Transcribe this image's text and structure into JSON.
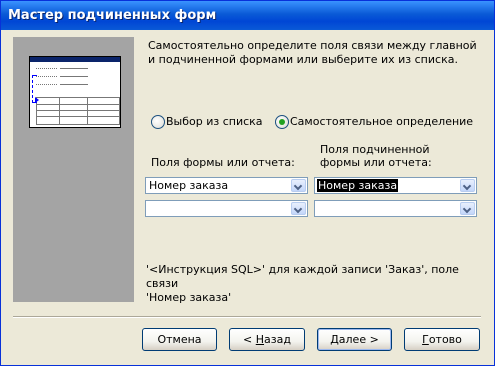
{
  "window": {
    "title": "Мастер подчиненных форм"
  },
  "description": "Самостоятельно определите поля связи между главной и подчиненной формами или выберите их из списка.",
  "radios": [
    {
      "label": "Выбор из списка",
      "selected": false
    },
    {
      "label": "Самостоятельное определение",
      "selected": true
    }
  ],
  "main_fields": {
    "header": "Поля формы или отчета:",
    "row1_value": "Номер заказа",
    "row2_value": ""
  },
  "sub_fields": {
    "header_line1": "Поля подчиненной",
    "header_line2": "формы или отчета:",
    "row1_value": "Номер заказа",
    "row2_value": ""
  },
  "note_line1": "'<Инструкция SQL>' для каждой записи 'Заказ', поле связи",
  "note_line2": "'Номер заказа'",
  "buttons": {
    "cancel": "Отмена",
    "back_prefix": "< ",
    "back_key": "Н",
    "back_rest": "азад",
    "next_key": "Д",
    "next_rest": "алее >",
    "finish_key": "Г",
    "finish_rest": "отово"
  },
  "colors": {
    "accent": "#0a246a",
    "radio_dot": "#21a121"
  },
  "icons": [
    "dropdown-arrow-icon"
  ]
}
